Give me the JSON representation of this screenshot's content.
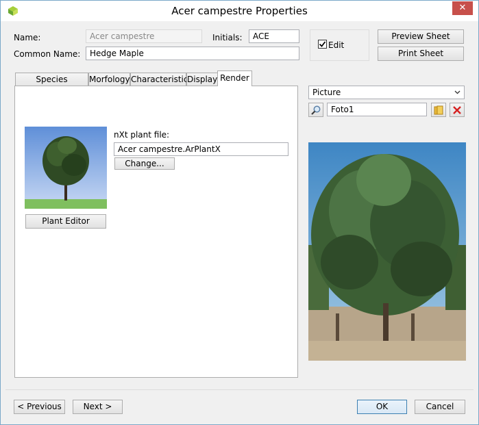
{
  "window": {
    "title": "Acer campestre Properties",
    "close_glyph": "✕"
  },
  "form": {
    "name_label": "Name:",
    "name_value": "Acer campestre",
    "initials_label": "Initials:",
    "initials_value": "ACE",
    "common_name_label": "Common Name:",
    "common_name_value": "Hedge Maple",
    "edit_label": "Edit",
    "edit_checked": true,
    "preview_sheet": "Preview Sheet",
    "print_sheet": "Print Sheet"
  },
  "tabs": [
    {
      "label": "Species Information"
    },
    {
      "label": "Morfology"
    },
    {
      "label": "Characteristics"
    },
    {
      "label": "Display"
    },
    {
      "label": "Render"
    }
  ],
  "render": {
    "nxt_label": "nXt plant file:",
    "nxt_file": "Acer campestre.ArPlantX",
    "change_button": "Change...",
    "plant_editor_button": "Plant Editor"
  },
  "picture": {
    "type_select": "Picture",
    "image_name": "Foto1"
  },
  "footer": {
    "previous": "< Previous",
    "next": "Next >",
    "ok": "OK",
    "cancel": "Cancel"
  },
  "colors": {
    "accent_border": "#3c7fb1",
    "close_red": "#c7504b"
  }
}
